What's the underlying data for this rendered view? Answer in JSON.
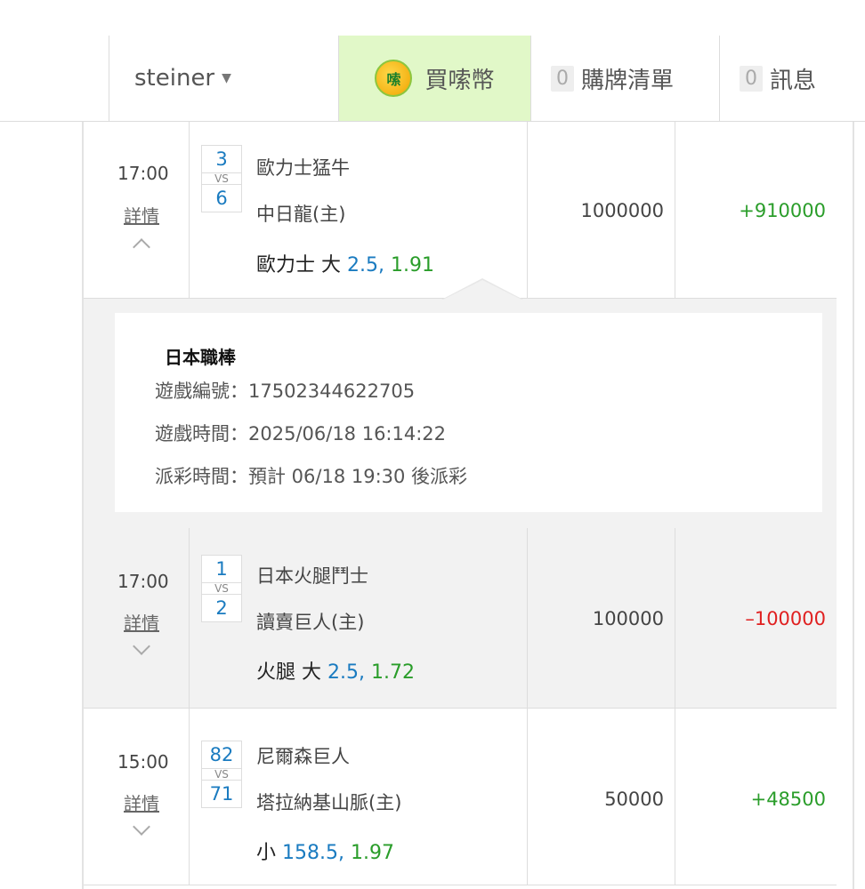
{
  "header": {
    "username": "steiner",
    "buy_coin_label": "買嗦幣",
    "coin_icon_text": "嗦",
    "cart": {
      "count": "0",
      "label": "購牌清單"
    },
    "messages": {
      "count": "0",
      "label": "訊息"
    }
  },
  "bets": [
    {
      "time": "17:00",
      "detail_label": "詳情",
      "expanded": true,
      "away_score": "3",
      "home_score": "6",
      "vs": "VS",
      "away_team": "歐力士猛牛",
      "home_team": "中日龍(主)",
      "pick_team": "歐力士",
      "pick_type": "大",
      "pick_line": "2.5,",
      "pick_odds": "1.91",
      "stake": "1000000",
      "result": "+910000"
    },
    {
      "time": "17:00",
      "detail_label": "詳情",
      "expanded": false,
      "away_score": "1",
      "home_score": "2",
      "vs": "VS",
      "away_team": "日本火腿鬥士",
      "home_team": "讀賣巨人(主)",
      "pick_team": "火腿",
      "pick_type": "大",
      "pick_line": "2.5,",
      "pick_odds": "1.72",
      "stake": "100000",
      "result": "–100000"
    },
    {
      "time": "15:00",
      "detail_label": "詳情",
      "expanded": false,
      "away_score": "82",
      "home_score": "71",
      "vs": "VS",
      "away_team": "尼爾森巨人",
      "home_team": "塔拉納基山脈(主)",
      "pick_team": "",
      "pick_type": "小",
      "pick_line": "158.5,",
      "pick_odds": "1.97",
      "stake": "50000",
      "result": "+48500"
    }
  ],
  "detail": {
    "league": "日本職棒",
    "game_id": "遊戲編號：17502344622705",
    "game_time": "遊戲時間：2025/06/18 16:14:22",
    "payout_time": "派彩時間：預計 06/18 19:30 後派彩"
  },
  "colors": {
    "positive": "#2a9d2a",
    "negative": "#e02020",
    "link_blue": "#1a7bc0",
    "coin_bg": "#e1f8c8"
  }
}
